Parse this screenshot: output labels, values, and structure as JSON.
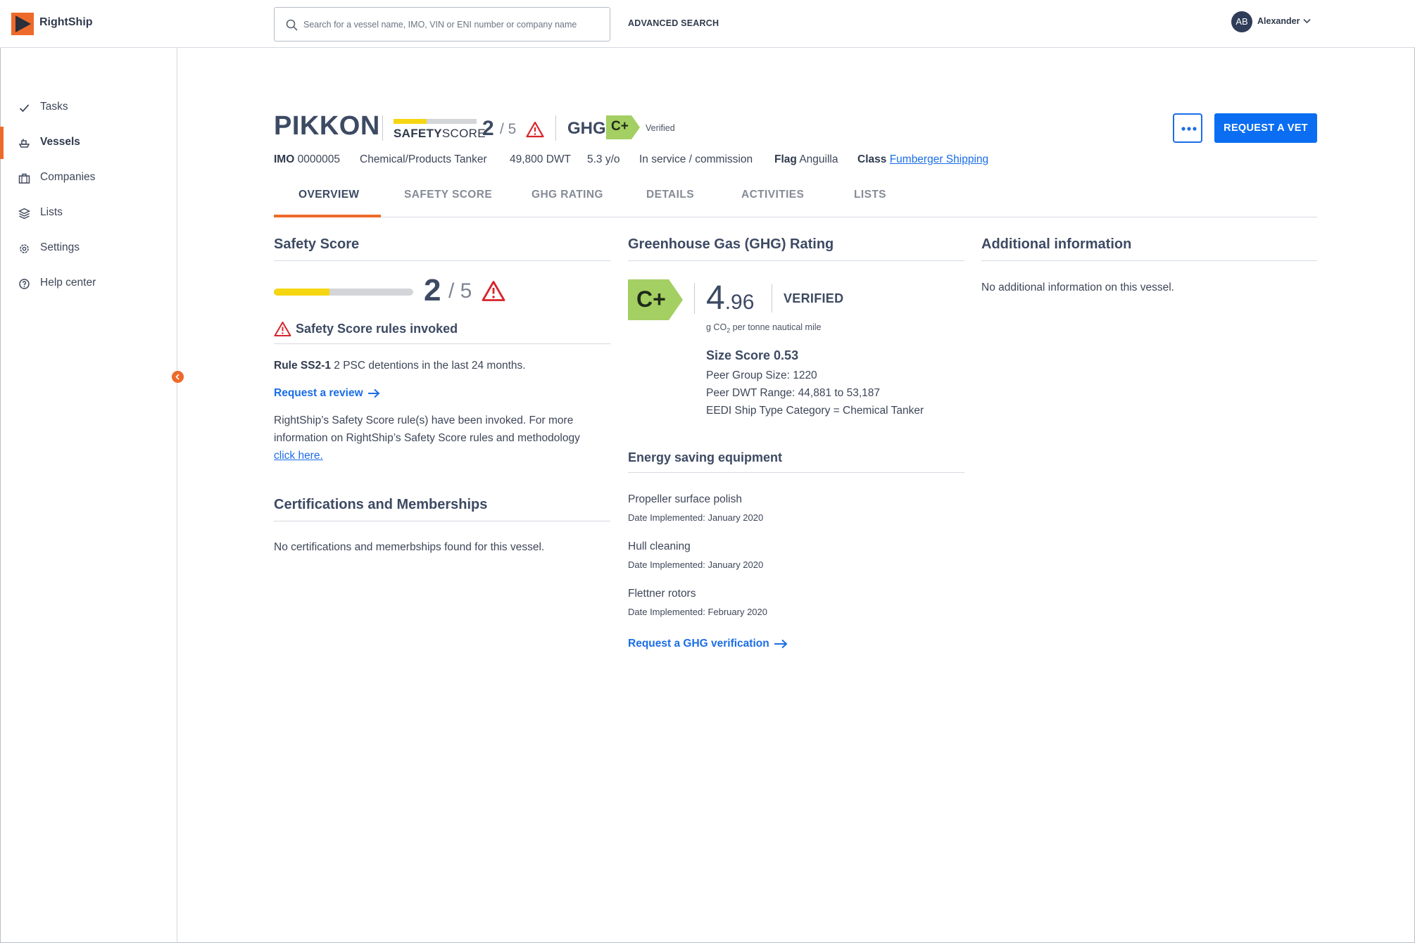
{
  "app": {
    "brand": "RightShip",
    "colors": {
      "accent": "#ee6a2a",
      "primary": "#0b6ef2",
      "safety_bar": "#f5d611",
      "ghg_badge": "#a4cf62",
      "warning": "#d8232a"
    }
  },
  "topbar": {
    "search_placeholder": "Search for a vessel name, IMO, VIN or ENI number or company name",
    "advanced_search": "ADVANCED SEARCH",
    "user": {
      "initials": "AB",
      "name": "Alexander"
    }
  },
  "sidebar": {
    "items": [
      {
        "label": "Tasks",
        "icon": "check-icon"
      },
      {
        "label": "Vessels",
        "icon": "ship-icon",
        "active": true
      },
      {
        "label": "Companies",
        "icon": "briefcase-icon"
      },
      {
        "label": "Lists",
        "icon": "layers-icon"
      },
      {
        "label": "Settings",
        "icon": "gear-icon"
      },
      {
        "label": "Help center",
        "icon": "help-icon"
      }
    ]
  },
  "vessel": {
    "name": "PIKKON",
    "safety_label_bold": "SAFETY",
    "safety_label_rest": "SCORE",
    "safety_score": "2",
    "safety_max": "/ 5",
    "safety_fraction": 0.4,
    "ghg_label": "GHG",
    "ghg_rating": "C+",
    "ghg_status": "Verified",
    "imo_label": "IMO",
    "imo": "0000005",
    "type": "Chemical/Products Tanker",
    "dwt": "49,800 DWT",
    "age": "5.3 y/o",
    "status": "In service / commission",
    "flag_label": "Flag",
    "flag": "Anguilla",
    "class_label": "Class",
    "class": "Fumberger Shipping"
  },
  "actions": {
    "more": "more-options",
    "request_vet": "REQUEST A VET"
  },
  "tabs": [
    "OVERVIEW",
    "SAFETY SCORE",
    "GHG RATING",
    "DETAILS",
    "ACTIVITIES",
    "LISTS"
  ],
  "safety_section": {
    "title": "Safety Score",
    "rules_title": "Safety Score rules invoked",
    "rule_id": "Rule SS2-1",
    "rule_text": "2 PSC detentions in the last 24 months.",
    "review_link": "Request a review",
    "info_line1": "RightShip’s Safety Score rule(s) have been invoked. For more",
    "info_line2": "information on RightShip’s Safety Score rules and methodology",
    "info_link": "click here."
  },
  "cert_section": {
    "title": "Certifications and Memberships",
    "empty": "No certifications and memerbships found for this vessel."
  },
  "ghg_section": {
    "title": "Greenhouse Gas (GHG) Rating",
    "value_int": "4",
    "value_dec": ".96",
    "verified": "VERIFIED",
    "unit_pre": "g CO",
    "unit_sub": "2",
    "unit_post": " per tonne nautical mile",
    "size_score": "Size Score 0.53",
    "peer_group": "Peer Group Size: 1220",
    "peer_dwt": "Peer DWT Range: 44,881 to 53,187",
    "eedi": "EEDI Ship Type Category = Chemical Tanker"
  },
  "energy_section": {
    "title": "Energy saving equipment",
    "items": [
      {
        "name": "Propeller surface polish",
        "date": "Date Implemented: January 2020"
      },
      {
        "name": "Hull cleaning",
        "date": "Date Implemented: January 2020"
      },
      {
        "name": "Flettner rotors",
        "date": "Date Implemented: February 2020"
      }
    ],
    "link": "Request a GHG verification"
  },
  "additional_section": {
    "title": "Additional information",
    "empty": "No additional information on this vessel."
  }
}
